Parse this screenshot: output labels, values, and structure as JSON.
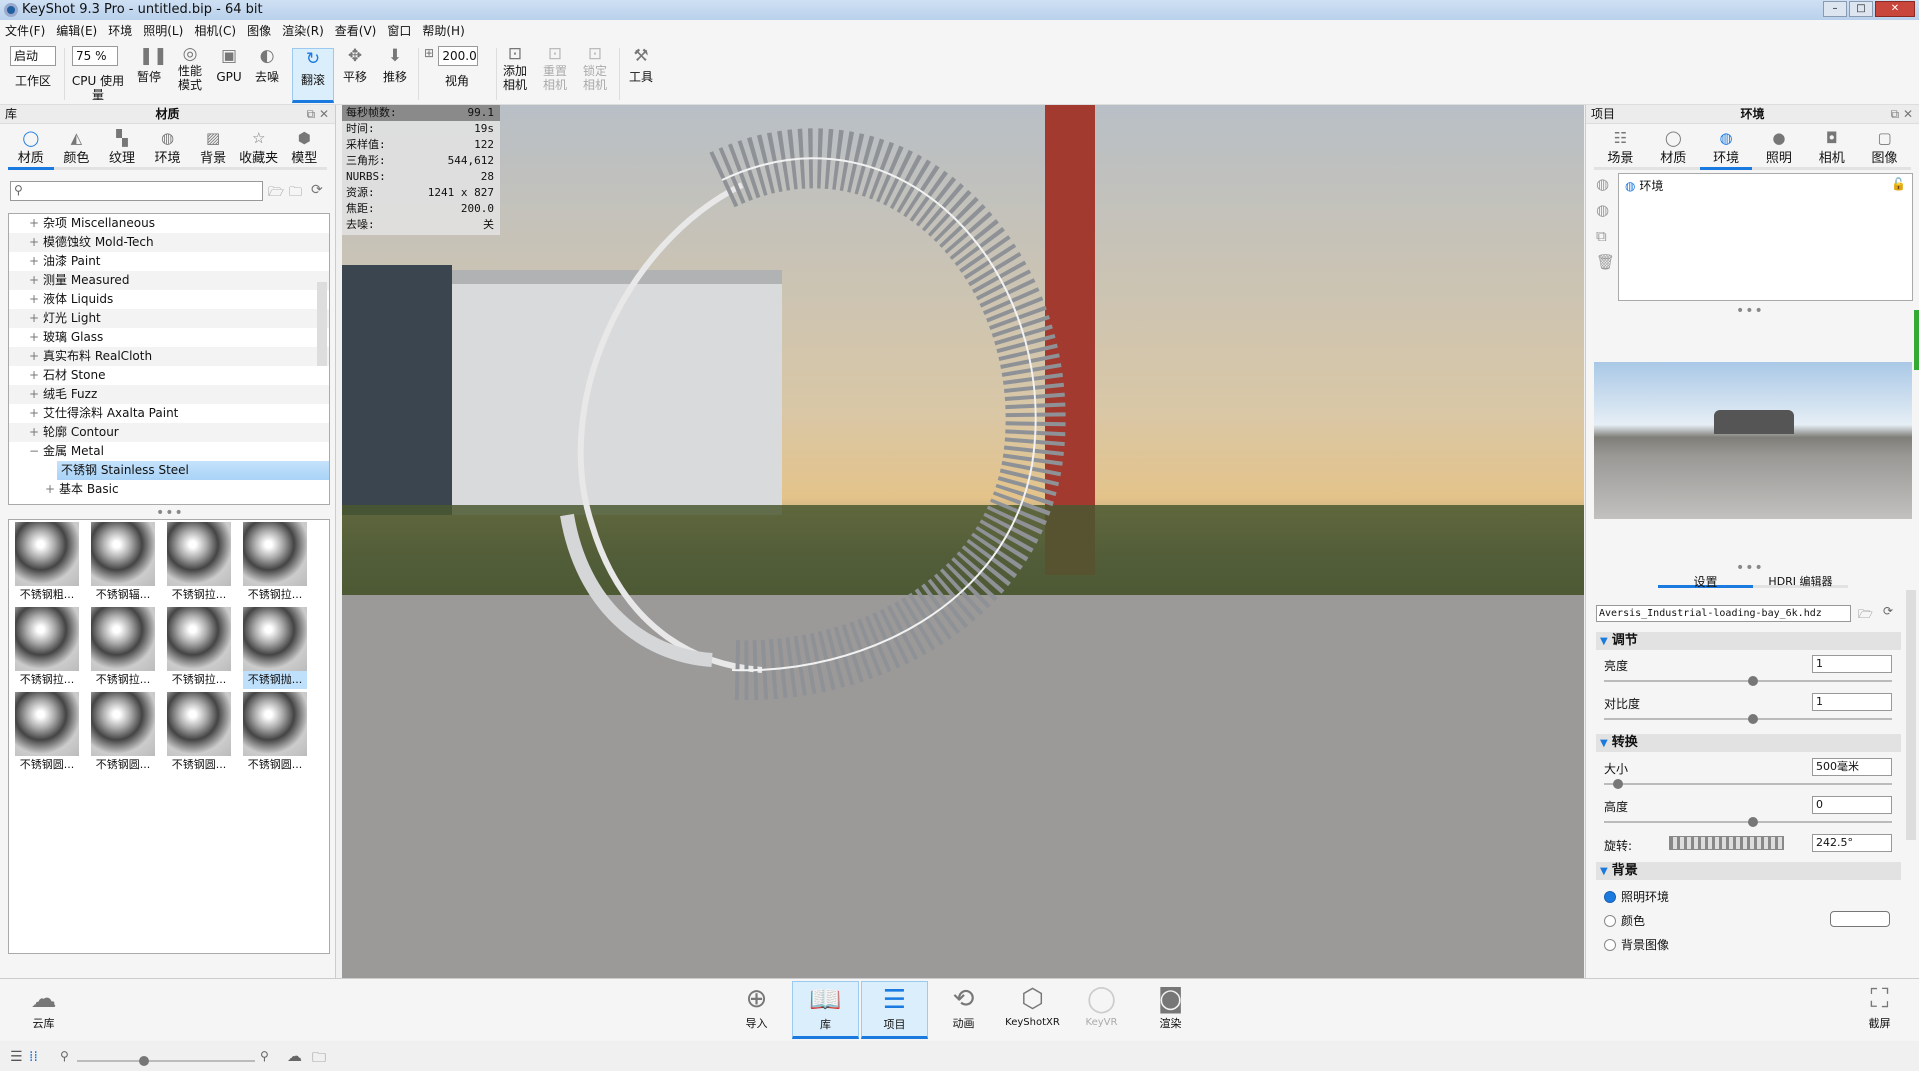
{
  "window": {
    "title": "KeyShot 9.3 Pro  - untitled.bip  - 64 bit"
  },
  "menu": [
    "文件(F)",
    "编辑(E)",
    "环境",
    "照明(L)",
    "相机(C)",
    "图像",
    "渲染(R)",
    "查看(V)",
    "窗口",
    "帮助(H)"
  ],
  "toolbar": {
    "workspace_value": "启动",
    "workspace_label": "工作区",
    "cpu_value": "75 %",
    "cpu_label": "CPU 使用量",
    "pause": "暂停",
    "perf_line1": "性能",
    "perf_line2": "模式",
    "gpu": "GPU",
    "denoise": "去噪",
    "tumble": "翻滚",
    "pan": "平移",
    "dolly": "推移",
    "fov_value": "200.0",
    "fov_label": "视角",
    "add_cam_1": "添加",
    "add_cam_2": "相机",
    "reset_cam_1": "重置",
    "reset_cam_2": "相机",
    "lock_cam_1": "锁定",
    "lock_cam_2": "相机",
    "tools": "工具"
  },
  "library": {
    "left_title": "库",
    "title": "材质",
    "tabs": [
      "材质",
      "颜色",
      "纹理",
      "环境",
      "背景",
      "收藏夹",
      "模型"
    ],
    "search_placeholder": "",
    "tree": [
      "杂项 Miscellaneous",
      "模德蚀纹 Mold-Tech",
      "油漆 Paint",
      "测量 Measured",
      "液体 Liquids",
      "灯光 Light",
      "玻璃 Glass",
      "真实布料 RealCloth",
      "石材 Stone",
      "绒毛 Fuzz",
      "艾仕得涂料 Axalta Paint",
      "轮廓 Contour",
      "金属 Metal"
    ],
    "tree_selected": "不锈钢 Stainless Steel",
    "tree_sub": "基本 Basic",
    "thumbs": [
      "不锈钢粗...",
      "不锈钢辐...",
      "不锈钢拉...",
      "不锈钢拉...",
      "不锈钢拉...",
      "不锈钢拉...",
      "不锈钢拉...",
      "不锈钢抛...",
      "不锈钢圆...",
      "不锈钢圆...",
      "不锈钢圆...",
      "不锈钢圆..."
    ]
  },
  "stats": [
    [
      "每秒帧数:",
      "99.1"
    ],
    [
      "时间:",
      "19s"
    ],
    [
      "采样值:",
      "122"
    ],
    [
      "三角形:",
      "544,612"
    ],
    [
      "NURBS:",
      "28"
    ],
    [
      "资源:",
      "1241 x 827"
    ],
    [
      "焦距:",
      "200.0"
    ],
    [
      "去噪:",
      "关"
    ]
  ],
  "project": {
    "left_title": "项目",
    "title": "环境",
    "tabs": [
      "场景",
      "材质",
      "环境",
      "照明",
      "相机",
      "图像"
    ],
    "env_item": "环境",
    "subtabs": [
      "设置",
      "HDRI 编辑器"
    ],
    "hdri_file": "Aversis_Industrial-loading-bay_6k.hdz",
    "sec_adjust": "调节",
    "brightness_label": "亮度",
    "brightness": "1",
    "contrast_label": "对比度",
    "contrast": "1",
    "sec_transform": "转换",
    "size_label": "大小",
    "size": "500毫米",
    "height_label": "高度",
    "height": "0",
    "rotation_label": "旋转:",
    "rotation": "242.5°",
    "sec_background": "背景",
    "bg_options": [
      "照明环境",
      "颜色",
      "背景图像"
    ]
  },
  "slider_values": {
    "brightness": 0.5,
    "contrast": 0.5,
    "size": 0.03,
    "height": 0.5,
    "thumb_size": 0.35
  },
  "bottom": {
    "cloud": "云库",
    "import": "导入",
    "library": "库",
    "project": "项目",
    "animation": "动画",
    "xr": "KeyShotXR",
    "vr": "KeyVR",
    "render": "渲染",
    "screenshot": "截屏"
  }
}
